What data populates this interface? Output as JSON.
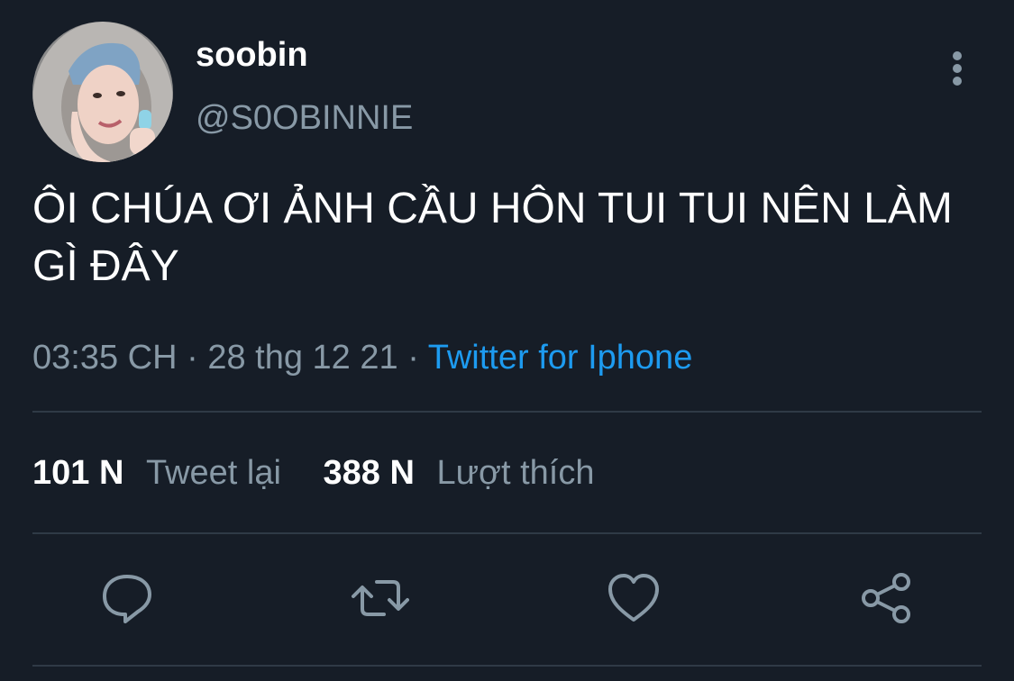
{
  "user": {
    "display_name": "soobin",
    "handle": "@S0OBINNIE"
  },
  "tweet": {
    "text": "ÔI CHÚA ƠI ẢNH CẦU HÔN TUI TUI NÊN LÀM GÌ ĐÂY",
    "time": "03:35 CH",
    "sep1": "·",
    "date": "28 thg 12 21",
    "sep2": "·",
    "source": "Twitter for Iphone"
  },
  "stats": {
    "retweets_count": "101 N",
    "retweets_label": "Tweet lại",
    "likes_count": "388 N",
    "likes_label": "Lượt thích"
  },
  "icons": {
    "reply": "reply-icon",
    "retweet": "retweet-icon",
    "like": "heart-icon",
    "share": "share-icon",
    "more": "more-vertical-icon"
  },
  "colors": {
    "background": "#161d27",
    "accent": "#1d9bf0",
    "muted": "#8899a6"
  }
}
